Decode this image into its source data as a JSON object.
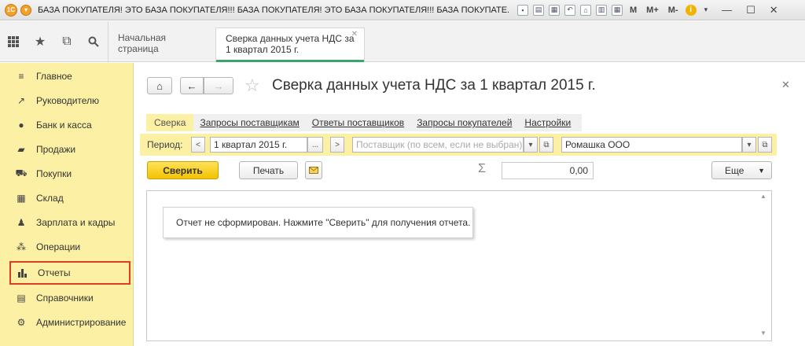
{
  "window": {
    "title": "БАЗА ПОКУПАТЕЛЯ! ЭТО БАЗА ПОКУПАТЕЛЯ!!! БАЗА ПОКУПАТЕЛЯ! ЭТО БАЗА ПОКУПАТЕЛЯ!!! БАЗА ПОКУПАТЕ... (1С:Предприятие)",
    "m_buttons": [
      "M",
      "M+",
      "M-"
    ]
  },
  "tabs": [
    {
      "label": "Начальная страница"
    },
    {
      "label": "Сверка данных учета НДС за 1 квартал 2015 г."
    }
  ],
  "sidebar": {
    "items": [
      {
        "label": "Главное",
        "icon": "menu-icon"
      },
      {
        "label": "Руководителю",
        "icon": "trend-icon"
      },
      {
        "label": "Банк и касса",
        "icon": "coin-icon"
      },
      {
        "label": "Продажи",
        "icon": "bag-icon"
      },
      {
        "label": "Покупки",
        "icon": "cart-icon"
      },
      {
        "label": "Склад",
        "icon": "warehouse-icon"
      },
      {
        "label": "Зарплата и кадры",
        "icon": "person-icon"
      },
      {
        "label": "Операции",
        "icon": "operations-icon"
      },
      {
        "label": "Отчеты",
        "icon": "bar-chart-icon"
      },
      {
        "label": "Справочники",
        "icon": "book-icon"
      },
      {
        "label": "Администрирование",
        "icon": "gear-icon"
      }
    ]
  },
  "page": {
    "title": "Сверка данных учета НДС за 1 квартал 2015 г."
  },
  "form_tabs": [
    {
      "label": "Сверка"
    },
    {
      "label": "Запросы поставщикам"
    },
    {
      "label": "Ответы поставщиков"
    },
    {
      "label": "Запросы покупателей"
    },
    {
      "label": "Настройки"
    }
  ],
  "period": {
    "label": "Период:",
    "value": "1 квартал 2015 г.",
    "supplier_placeholder": "Поставщик (по всем, если не выбран)",
    "organization": "Ромашка ООО"
  },
  "actions": {
    "reconcile_label": "Сверить",
    "print_label": "Печать",
    "sum_value": "0,00",
    "more_label": "Еще"
  },
  "report": {
    "message": "Отчет не сформирован. Нажмите \"Сверить\" для получения отчета."
  }
}
